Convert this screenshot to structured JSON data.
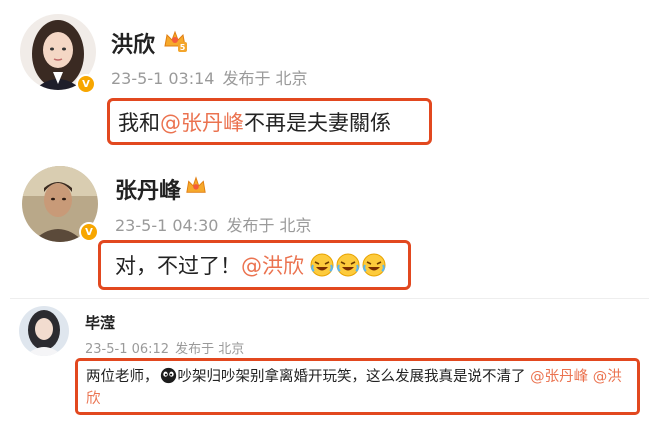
{
  "post1": {
    "username": "洪欣",
    "date": "23-5-1 03:14",
    "source": "发布于 北京",
    "text_before": "我和",
    "mention": "@张丹峰",
    "text_after": " 不再是夫妻關係",
    "level_badge": "5",
    "verified_mark": "V"
  },
  "post2": {
    "username": "张丹峰",
    "date": "23-5-1 04:30",
    "source": "发布于 北京",
    "text_before": "对，不过了！",
    "mention": "@洪欣",
    "emoji_icons": [
      "laugh-cry-emoji",
      "laugh-cry-emoji",
      "laugh-cry-emoji"
    ],
    "verified_mark": "V"
  },
  "comment": {
    "username": "毕滢",
    "date": "23-5-1 06:12",
    "source": "发布于 北京",
    "text_before": "两位老师，",
    "text_middle": "吵架归吵架别拿离婚开玩笑，这么发展我真是说不清了",
    "mention1": "@张丹峰",
    "mention2": "@洪欣"
  },
  "colors": {
    "highlight_border": "#e2481f",
    "mention": "#eb7350",
    "meta": "#9a9a9a",
    "verified": "#f7a600"
  }
}
